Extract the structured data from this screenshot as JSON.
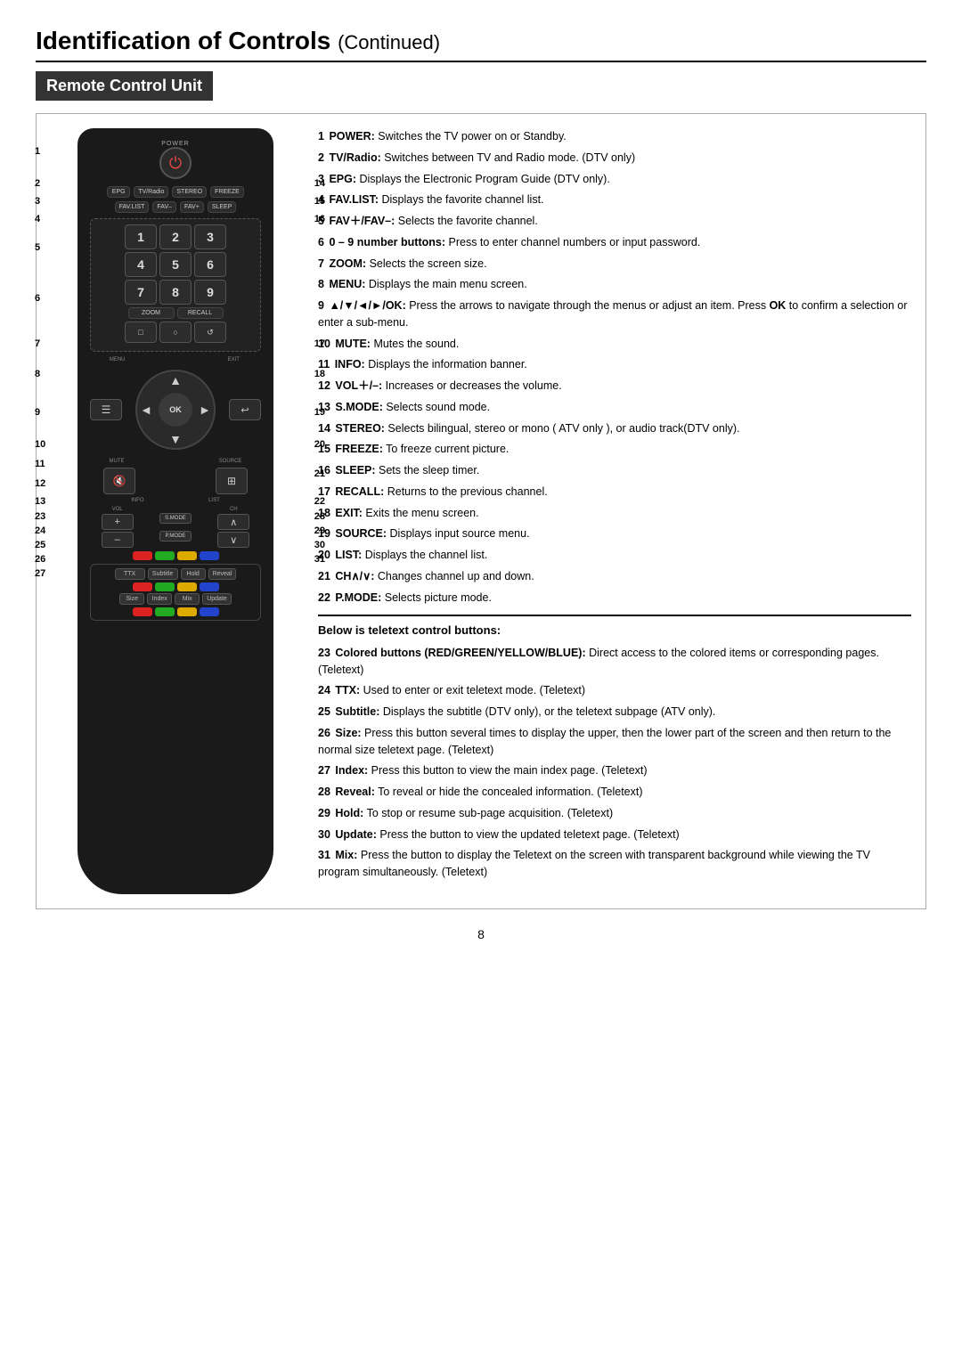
{
  "page": {
    "title": "Identification of Controls",
    "title_continued": "Continued",
    "section": "Remote Control Unit",
    "page_number": "8"
  },
  "remote": {
    "power_label": "POWER",
    "power_icon": "⏻",
    "row2_btns": [
      "EPG",
      "TV/Radio",
      "STEREO",
      "FREEZE"
    ],
    "row3_btns": [
      "FAV.LIST",
      "FAV–",
      "FAV+",
      "SLEEP"
    ],
    "numpad": [
      [
        "1",
        "2",
        "3"
      ],
      [
        "4",
        "5",
        "6"
      ],
      [
        "7",
        "8",
        "9"
      ]
    ],
    "special_btns": [
      "ZOOM",
      "RECALL"
    ],
    "shape_btns": [
      "□",
      "○",
      "↺"
    ],
    "menu_exit": [
      "MENU",
      "EXIT"
    ],
    "nav_ok": "OK",
    "mute_label": "MUTE",
    "source_label": "SOURCE",
    "mute_icon": "🔇",
    "source_icon": "⊞",
    "info_list": [
      "INFO",
      "LIST"
    ],
    "vol_label": "VOL",
    "smode_label": "S.MODE",
    "pmode_label": "P.MODE",
    "ch_label": "CH",
    "color_btns": [
      "red",
      "green",
      "yellow",
      "blue"
    ],
    "teletext_row1": [
      "TTX",
      "Subtitle",
      "Hold",
      "Reveal"
    ],
    "teletext_row2": [
      "Size",
      "Index",
      "Mix",
      "Update"
    ]
  },
  "descriptions": [
    {
      "num": "1",
      "bold": "POWER:",
      "text": "Switches the TV power on or Standby."
    },
    {
      "num": "2",
      "bold": "TV/Radio:",
      "text": "Switches between TV and Radio mode. (DTV only)"
    },
    {
      "num": "3",
      "bold": "EPG:",
      "text": "Displays the Electronic Program Guide (DTV only)."
    },
    {
      "num": "4",
      "bold": "FAV.LIST:",
      "text": "Displays the favorite channel list."
    },
    {
      "num": "5",
      "bold": "FAV＋/FAV–:",
      "text": "Selects the favorite channel."
    },
    {
      "num": "6",
      "bold": "0 – 9 number buttons:",
      "text": "Press to enter channel numbers or input password."
    },
    {
      "num": "7",
      "bold": "ZOOM:",
      "text": "Selects the screen size."
    },
    {
      "num": "8",
      "bold": "MENU:",
      "text": "Displays the main menu screen."
    },
    {
      "num": "9",
      "bold": "▲/▼/◄/►/OK:",
      "text": "Press the arrows to navigate through the menus or adjust an item. Press OK to confirm a selection or enter a sub-menu."
    },
    {
      "num": "10",
      "bold": "MUTE:",
      "text": "Mutes the sound."
    },
    {
      "num": "11",
      "bold": "INFO:",
      "text": "Displays the information banner."
    },
    {
      "num": "12",
      "bold": "VOL＋/–:",
      "text": "Increases or decreases the volume."
    },
    {
      "num": "13",
      "bold": "S.MODE:",
      "text": "Selects sound mode."
    },
    {
      "num": "14",
      "bold": "STEREO:",
      "text": "Selects bilingual, stereo or mono ( ATV only ), or audio track(DTV only)."
    },
    {
      "num": "15",
      "bold": "FREEZE:",
      "text": "To freeze current picture."
    },
    {
      "num": "16",
      "bold": "SLEEP:",
      "text": "Sets the sleep timer."
    },
    {
      "num": "17",
      "bold": "RECALL:",
      "text": "Returns to the previous channel."
    },
    {
      "num": "18",
      "bold": "EXIT:",
      "text": "Exits the menu screen."
    },
    {
      "num": "19",
      "bold": "SOURCE:",
      "text": "Displays input source menu."
    },
    {
      "num": "20",
      "bold": "LIST:",
      "text": "Displays the channel list."
    },
    {
      "num": "21",
      "bold": "CH∧/∨:",
      "text": "Changes channel up and down."
    },
    {
      "num": "22",
      "bold": "P.MODE:",
      "text": "Selects picture mode."
    }
  ],
  "teletext": {
    "header": "Below is teletext control buttons:",
    "items": [
      {
        "num": "23",
        "bold": "Colored buttons (RED/GREEN/YELLOW/BLUE):",
        "text": "Direct access to the colored items or corresponding pages. (Teletext)"
      },
      {
        "num": "24",
        "bold": "TTX:",
        "text": "Used to enter or exit teletext mode. (Teletext)"
      },
      {
        "num": "25",
        "bold": "Subtitle:",
        "text": "Displays the subtitle (DTV only), or the teletext subpage (ATV only)."
      },
      {
        "num": "26",
        "bold": "Size:",
        "text": "Press this button several times to display the upper, then the lower part of the screen and then return to the normal size teletext page. (Teletext)"
      },
      {
        "num": "27",
        "bold": "Index:",
        "text": "Press this button to view the main index page. (Teletext)"
      },
      {
        "num": "28",
        "bold": "Reveal:",
        "text": "To reveal or hide the concealed information. (Teletext)"
      },
      {
        "num": "29",
        "bold": "Hold:",
        "text": "To stop or resume sub-page acquisition. (Teletext)"
      },
      {
        "num": "30",
        "bold": "Update:",
        "text": "Press the button to view the updated teletext page. (Teletext)"
      },
      {
        "num": "31",
        "bold": "Mix:",
        "text": "Press the button to display the Teletext on the screen with transparent background while viewing the TV program simultaneously. (Teletext)"
      }
    ]
  },
  "side_labels": {
    "left": [
      "1",
      "2",
      "3",
      "4",
      "5",
      "6",
      "7",
      "8",
      "9",
      "10",
      "11",
      "12",
      "13",
      "23",
      "24",
      "25",
      "26",
      "27"
    ],
    "right": [
      "14",
      "15",
      "16",
      "17",
      "18",
      "19",
      "20",
      "21",
      "22",
      "28",
      "29",
      "30",
      "31"
    ]
  }
}
